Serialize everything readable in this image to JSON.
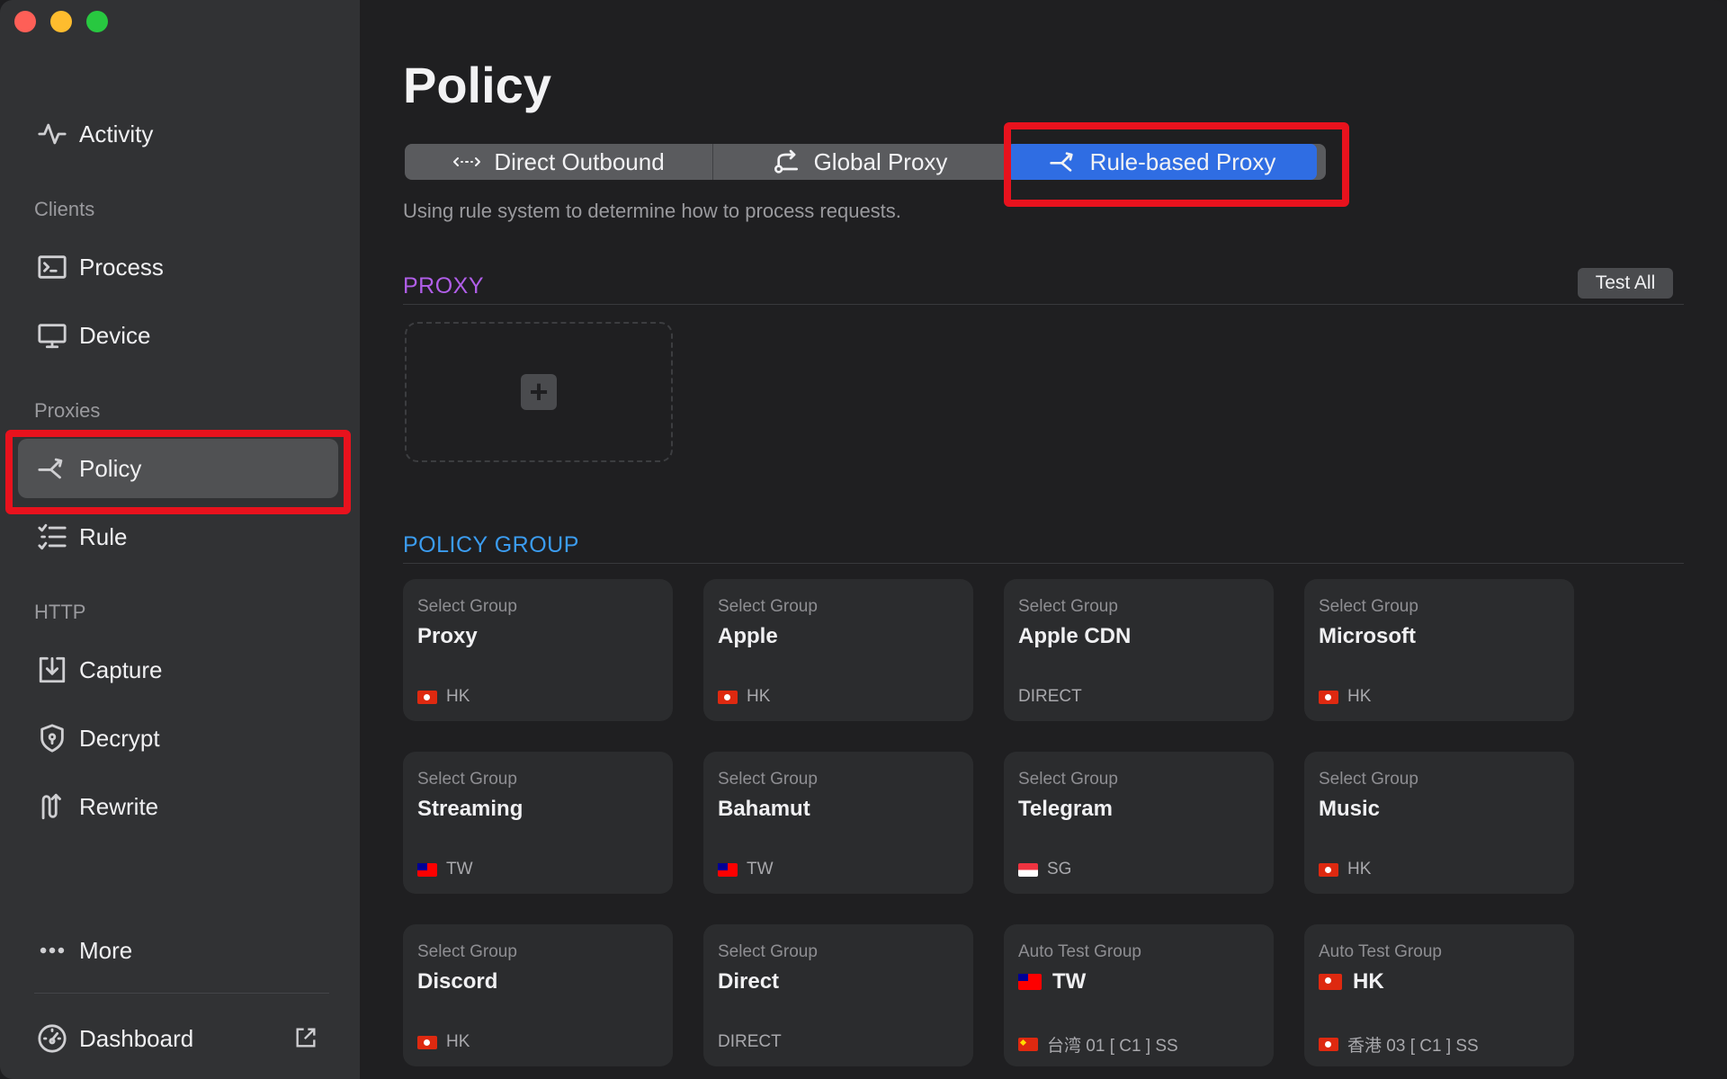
{
  "sidebar": {
    "activity": "Activity",
    "clients_header": "Clients",
    "process": "Process",
    "device": "Device",
    "proxies_header": "Proxies",
    "policy": "Policy",
    "rule": "Rule",
    "http_header": "HTTP",
    "capture": "Capture",
    "decrypt": "Decrypt",
    "rewrite": "Rewrite",
    "more": "More",
    "dashboard": "Dashboard"
  },
  "main": {
    "title": "Policy",
    "modes": [
      "Direct Outbound",
      "Global Proxy",
      "Rule-based Proxy"
    ],
    "selected_mode": "Rule-based Proxy",
    "description": "Using rule system to determine how to process requests.",
    "proxy_section": "PROXY",
    "test_all": "Test All",
    "add_symbol": "+",
    "policy_group_section": "POLICY GROUP",
    "groups": [
      {
        "type": "Select Group",
        "name": "Proxy",
        "selected": "HK",
        "flag": "hk"
      },
      {
        "type": "Select Group",
        "name": "Apple",
        "selected": "HK",
        "flag": "hk"
      },
      {
        "type": "Select Group",
        "name": "Apple CDN",
        "selected": "DIRECT",
        "flag": ""
      },
      {
        "type": "Select Group",
        "name": "Microsoft",
        "selected": "HK",
        "flag": "hk"
      },
      {
        "type": "Select Group",
        "name": "Streaming",
        "selected": "TW",
        "flag": "tw"
      },
      {
        "type": "Select Group",
        "name": "Bahamut",
        "selected": "TW",
        "flag": "tw"
      },
      {
        "type": "Select Group",
        "name": "Telegram",
        "selected": "SG",
        "flag": "sg"
      },
      {
        "type": "Select Group",
        "name": "Music",
        "selected": "HK",
        "flag": "hk"
      },
      {
        "type": "Select Group",
        "name": "Discord",
        "selected": "HK",
        "flag": "hk"
      },
      {
        "type": "Select Group",
        "name": "Direct",
        "selected": "DIRECT",
        "flag": ""
      },
      {
        "type": "Auto Test Group",
        "name": "TW",
        "selected": "台湾 01 [ C1 ] SS",
        "flag": "cn",
        "name_flag": "tw"
      },
      {
        "type": "Auto Test Group",
        "name": "HK",
        "selected": "香港 03 [ C1 ] SS",
        "flag": "hk",
        "name_flag": "hk"
      }
    ]
  },
  "colors": {
    "accent_blue": "#2f6de3",
    "proxy_label": "#b05ee8",
    "policy_group_label": "#3b9cf0",
    "highlight_red": "#e8121d"
  },
  "icons": {
    "activity": "activity-pulse-icon",
    "process": "terminal-icon",
    "device": "monitor-icon",
    "policy": "branch-icon",
    "rule": "checklist-icon",
    "capture": "download-tray-icon",
    "decrypt": "shield-icon",
    "rewrite": "rewrite-icon",
    "more": "ellipsis-icon",
    "dashboard": "gauge-icon",
    "external": "external-link-icon"
  }
}
